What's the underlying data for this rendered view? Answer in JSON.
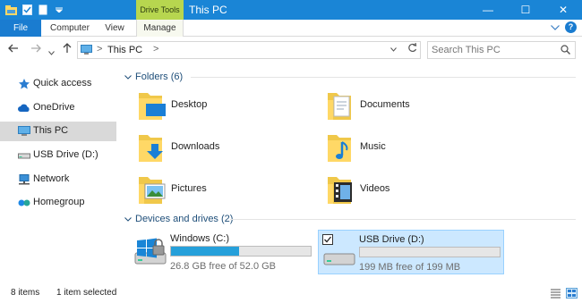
{
  "titlebar": {
    "contextual_tab": "Drive Tools",
    "title": "This PC",
    "minimize": "—",
    "maximize": "☐",
    "close": "✕"
  },
  "ribbon": {
    "tabs": [
      "File",
      "Computer",
      "View",
      "Manage"
    ],
    "expand_icon": "chevron-down-icon",
    "help_label": "?"
  },
  "address": {
    "path": [
      "This PC"
    ],
    "separator": ">",
    "search_placeholder": "Search This PC"
  },
  "sidebar": {
    "items": [
      {
        "label": "Quick access",
        "icon": "star-icon"
      },
      {
        "label": "OneDrive",
        "icon": "cloud-icon"
      },
      {
        "label": "This PC",
        "icon": "computer-icon",
        "selected": true
      },
      {
        "label": "USB Drive (D:)",
        "icon": "usb-drive-icon"
      },
      {
        "label": "Network",
        "icon": "network-icon"
      },
      {
        "label": "Homegroup",
        "icon": "homegroup-icon"
      }
    ]
  },
  "main": {
    "folders_header": "Folders (6)",
    "folders": [
      {
        "label": "Desktop",
        "icon": "desktop-folder-icon"
      },
      {
        "label": "Documents",
        "icon": "documents-folder-icon"
      },
      {
        "label": "Downloads",
        "icon": "downloads-folder-icon"
      },
      {
        "label": "Music",
        "icon": "music-folder-icon"
      },
      {
        "label": "Pictures",
        "icon": "pictures-folder-icon"
      },
      {
        "label": "Videos",
        "icon": "videos-folder-icon"
      }
    ],
    "drives_header": "Devices and drives (2)",
    "drives": [
      {
        "name": "Windows (C:)",
        "free_text": "26.8 GB free of 52.0 GB",
        "used_fraction": 0.485,
        "selected": false,
        "icon": "windows-drive-icon"
      },
      {
        "name": "USB Drive (D:)",
        "free_text": "199 MB free of 199 MB",
        "used_fraction": 0.0,
        "selected": true,
        "icon": "usb-drive-icon"
      }
    ]
  },
  "status": {
    "item_count": "8 items",
    "selection": "1 item selected"
  },
  "colors": {
    "accent": "#1a85d6",
    "contextual": "#b7d64f",
    "drive_fill": "#26a0da",
    "selection_bg": "#cce8ff"
  }
}
